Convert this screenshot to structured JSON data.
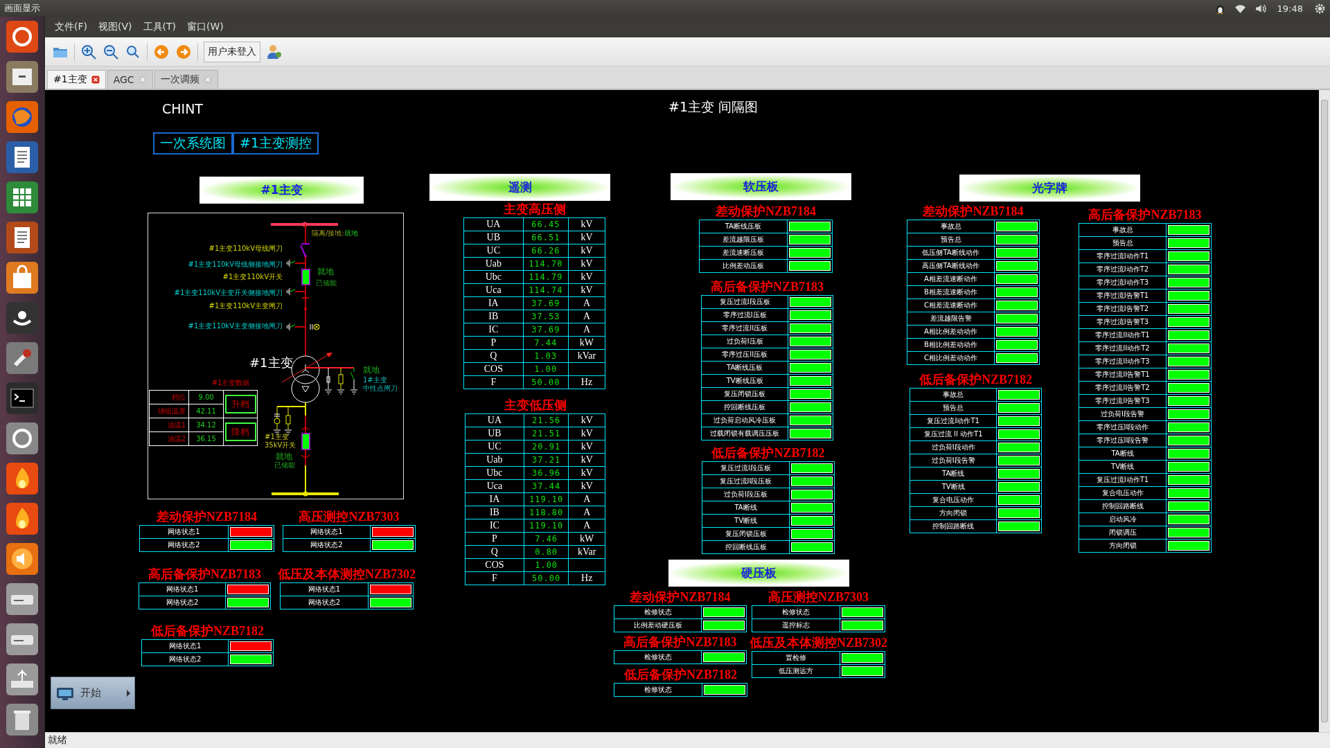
{
  "top_bar": {
    "title": "画面显示",
    "time": "19:48"
  },
  "menu": [
    "文件(F)",
    "视图(V)",
    "工具(T)",
    "窗口(W)"
  ],
  "toolbar": {
    "user_button": "用户未登入"
  },
  "tabs": [
    {
      "label": "#1主变",
      "selected": true
    },
    {
      "label": "AGC",
      "selected": false
    },
    {
      "label": "一次调频",
      "selected": false
    }
  ],
  "canvas": {
    "logo": "CHINT",
    "title": "#1主变 间隔图",
    "nav_buttons": [
      "一次系统图",
      "#1主变测控"
    ],
    "start_button": "开始"
  },
  "diagram": {
    "header": "#1主变",
    "isolation_label": "隔离/接地:",
    "isolation_mode": "就地",
    "device_labels": [
      {
        "text": "#1主变110kV母线闸刀",
        "kind": "switch"
      },
      {
        "text": "#1主变110kV母线侧接地闸刀",
        "kind": "ground_switch"
      },
      {
        "text": "#1主变110kV开关",
        "kind": "switch"
      },
      {
        "text": "#1主变110kV主变开关侧接地闸刀",
        "kind": "ground_switch"
      },
      {
        "text": "#1主变110kV主变闸刀",
        "kind": "switch"
      },
      {
        "text": "#1主变110kV主变侧接地闸刀",
        "kind": "ground_switch"
      }
    ],
    "breaker_110": {
      "mode": "就地",
      "status": "已储能"
    },
    "transformer": "#1主变",
    "neutral": {
      "mode": "就地",
      "name_1": "1#主变",
      "name_2": "中性点闸刀"
    },
    "breaker_35": {
      "name_1": "#1主变",
      "name_2": "35kV开关",
      "mode": "就地",
      "status": "已储能"
    },
    "data_title": "#1主变数据",
    "data": [
      {
        "label": "档位",
        "value": "9.00"
      },
      {
        "label": "绕组温度",
        "value": "42.11"
      },
      {
        "label": "油温1",
        "value": "34.12"
      },
      {
        "label": "油温2",
        "value": "36.15"
      }
    ],
    "buttons": [
      "升档",
      "降档"
    ]
  },
  "network_status": {
    "groups": [
      {
        "title": "差动保护NZB7184",
        "rows": [
          {
            "label": "网络状态1",
            "color": "#ff0000"
          },
          {
            "label": "网络状态2",
            "color": "#00ff00"
          }
        ]
      },
      {
        "title": "高压测控NZB7303",
        "rows": [
          {
            "label": "网络状态1",
            "color": "#ff0000"
          },
          {
            "label": "网络状态2",
            "color": "#00ff00"
          }
        ]
      },
      {
        "title": "高后备保护NZB7183",
        "rows": [
          {
            "label": "网络状态1",
            "color": "#ff0000"
          },
          {
            "label": "网络状态2",
            "color": "#00ff00"
          }
        ]
      },
      {
        "title": "低压及本体测控NZB7302",
        "rows": [
          {
            "label": "网络状态1",
            "color": "#ff0000"
          },
          {
            "label": "网络状态2",
            "color": "#00ff00"
          }
        ]
      },
      {
        "title": "低后备保护NZB7182",
        "rows": [
          {
            "label": "网络状态1",
            "color": "#ff0000"
          },
          {
            "label": "网络状态2",
            "color": "#00ff00"
          }
        ]
      }
    ]
  },
  "telemetry": {
    "header": "遥测",
    "groups": [
      {
        "title": "主变高压侧",
        "rows": [
          {
            "label": "UA",
            "value": "66.45",
            "unit": "kV"
          },
          {
            "label": "UB",
            "value": "66.51",
            "unit": "kV"
          },
          {
            "label": "UC",
            "value": "66.26",
            "unit": "kV"
          },
          {
            "label": "Uab",
            "value": "114.70",
            "unit": "kV"
          },
          {
            "label": "Ubc",
            "value": "114.79",
            "unit": "kV"
          },
          {
            "label": "Uca",
            "value": "114.74",
            "unit": "kV"
          },
          {
            "label": "IA",
            "value": "37.69",
            "unit": "A"
          },
          {
            "label": "IB",
            "value": "37.53",
            "unit": "A"
          },
          {
            "label": "IC",
            "value": "37.69",
            "unit": "A"
          },
          {
            "label": "P",
            "value": "7.44",
            "unit": "kW"
          },
          {
            "label": "Q",
            "value": "1.03",
            "unit": "kVar"
          },
          {
            "label": "COS",
            "value": "1.00"
          },
          {
            "label": "F",
            "value": "50.00",
            "unit": "Hz"
          }
        ]
      },
      {
        "title": "主变低压侧",
        "rows": [
          {
            "label": "UA",
            "value": "21.56",
            "unit": "kV"
          },
          {
            "label": "UB",
            "value": "21.51",
            "unit": "kV"
          },
          {
            "label": "UC",
            "value": "20.91",
            "unit": "kV"
          },
          {
            "label": "Uab",
            "value": "37.21",
            "unit": "kV"
          },
          {
            "label": "Ubc",
            "value": "36.96",
            "unit": "kV"
          },
          {
            "label": "Uca",
            "value": "37.44",
            "unit": "kV"
          },
          {
            "label": "IA",
            "value": "119.10",
            "unit": "A"
          },
          {
            "label": "IB",
            "value": "118.80",
            "unit": "A"
          },
          {
            "label": "IC",
            "value": "119.10",
            "unit": "A"
          },
          {
            "label": "P",
            "value": "7.46",
            "unit": "kW"
          },
          {
            "label": "Q",
            "value": "0.80",
            "unit": "kVar"
          },
          {
            "label": "COS",
            "value": "1.00"
          },
          {
            "label": "F",
            "value": "50.00",
            "unit": "Hz"
          }
        ]
      }
    ]
  },
  "soft_plates": {
    "header": "软压板",
    "groups": [
      {
        "title": "差动保护NZB7184",
        "rows": [
          {
            "label": "TA断线压板",
            "color": "#00ff00"
          },
          {
            "label": "差流越限压板",
            "color": "#00ff00"
          },
          {
            "label": "差流速断压板",
            "color": "#00ff00"
          },
          {
            "label": "比例差动压板",
            "color": "#00ff00"
          }
        ]
      },
      {
        "title": "高后备保护NZB7183",
        "rows": [
          {
            "label": "复压过流I段压板",
            "color": "#00ff00"
          },
          {
            "label": "零序过流I压板",
            "color": "#00ff00"
          },
          {
            "label": "零序过流II压板",
            "color": "#00ff00"
          },
          {
            "label": "过负荷I压板",
            "color": "#00ff00"
          },
          {
            "label": "零序过压II压板",
            "color": "#00ff00"
          },
          {
            "label": "TA断线压板",
            "color": "#00ff00"
          },
          {
            "label": "TV断线压板",
            "color": "#00ff00"
          },
          {
            "label": "复压闭锁压板",
            "color": "#00ff00"
          },
          {
            "label": "控回断线压板",
            "color": "#00ff00"
          },
          {
            "label": "过负荷启动风冷压板",
            "color": "#00ff00"
          },
          {
            "label": "过载闭锁有载调压压板",
            "color": "#00ff00"
          }
        ]
      },
      {
        "title": "低后备保护NZB7182",
        "rows": [
          {
            "label": "复压过流I段压板",
            "color": "#00ff00"
          },
          {
            "label": "复压过流II段压板",
            "color": "#00ff00"
          },
          {
            "label": "过负荷I段压板",
            "color": "#00ff00"
          },
          {
            "label": "TA断线",
            "color": "#00ff00"
          },
          {
            "label": "TV断线",
            "color": "#00ff00"
          },
          {
            "label": "复压闭锁压板",
            "color": "#00ff00"
          },
          {
            "label": "控回断线压板",
            "color": "#00ff00"
          }
        ]
      }
    ]
  },
  "hard_plates": {
    "header": "硬压板",
    "groups": [
      {
        "title": "差动保护NZB7184",
        "rows": [
          {
            "label": "检修状态",
            "color": "#00ff00"
          },
          {
            "label": "比例差动硬压板",
            "color": "#00ff00"
          }
        ]
      },
      {
        "title": "高压测控NZB7303",
        "rows": [
          {
            "label": "检修状态",
            "color": "#00ff00"
          },
          {
            "label": "遥控标志",
            "color": "#00ff00"
          }
        ]
      },
      {
        "title": "高后备保护NZB7183",
        "rows": [
          {
            "label": "检修状态",
            "color": "#00ff00"
          }
        ]
      },
      {
        "title": "低压及本体测控NZB7302",
        "rows": [
          {
            "label": "置检修",
            "color": "#00ff00"
          },
          {
            "label": "低压测远方",
            "color": "#00ff00"
          }
        ]
      },
      {
        "title": "低后备保护NZB7182",
        "rows": [
          {
            "label": "检修状态",
            "color": "#00ff00"
          }
        ]
      }
    ]
  },
  "lights": {
    "header": "光字牌",
    "groups": [
      {
        "title": "差动保护NZB7184",
        "rows": [
          {
            "label": "事故总",
            "color": "#00ff00"
          },
          {
            "label": "预告总",
            "color": "#00ff00"
          },
          {
            "label": "低压侧TA断线动作",
            "color": "#00ff00"
          },
          {
            "label": "高压侧TA断线动作",
            "color": "#00ff00"
          },
          {
            "label": "A相差流速断动作",
            "color": "#00ff00"
          },
          {
            "label": "B相差流速断动作",
            "color": "#00ff00"
          },
          {
            "label": "C相差流速断动作",
            "color": "#00ff00"
          },
          {
            "label": "差流越限告警",
            "color": "#00ff00"
          },
          {
            "label": "A相比例差动动作",
            "color": "#00ff00"
          },
          {
            "label": "B相比例差动动作",
            "color": "#00ff00"
          },
          {
            "label": "C相比例差动动作",
            "color": "#00ff00"
          }
        ]
      },
      {
        "title": "低后备保护NZB7182",
        "rows": [
          {
            "label": "事故总",
            "color": "#00ff00"
          },
          {
            "label": "预告总",
            "color": "#00ff00"
          },
          {
            "label": "复压过流I动作T1",
            "color": "#00ff00"
          },
          {
            "label": "复压过流 II 动作T1",
            "color": "#00ff00"
          },
          {
            "label": "过负荷I段动作",
            "color": "#00ff00"
          },
          {
            "label": "过负荷I段告警",
            "color": "#00ff00"
          },
          {
            "label": "TA断线",
            "color": "#00ff00"
          },
          {
            "label": "TV断线",
            "color": "#00ff00"
          },
          {
            "label": "复合电压动作",
            "color": "#00ff00"
          },
          {
            "label": "方向闭锁",
            "color": "#00ff00"
          },
          {
            "label": "控制回路断线",
            "color": "#00ff00"
          }
        ]
      },
      {
        "title": "高后备保护NZB7183",
        "rows": [
          {
            "label": "事故总",
            "color": "#00ff00"
          },
          {
            "label": "预告总",
            "color": "#00ff00"
          },
          {
            "label": "零序过流I动作T1",
            "color": "#00ff00"
          },
          {
            "label": "零序过流I动作T2",
            "color": "#00ff00"
          },
          {
            "label": "零序过流I动作T3",
            "color": "#00ff00"
          },
          {
            "label": "零序过流I告警T1",
            "color": "#00ff00"
          },
          {
            "label": "零序过流I告警T2",
            "color": "#00ff00"
          },
          {
            "label": "零序过流I告警T3",
            "color": "#00ff00"
          },
          {
            "label": "零序过流II动作T1",
            "color": "#00ff00"
          },
          {
            "label": "零序过流II动作T2",
            "color": "#00ff00"
          },
          {
            "label": "零序过流II动作T3",
            "color": "#00ff00"
          },
          {
            "label": "零序过流II告警T1",
            "color": "#00ff00"
          },
          {
            "label": "零序过流II告警T2",
            "color": "#00ff00"
          },
          {
            "label": "零序过流II告警T3",
            "color": "#00ff00"
          },
          {
            "label": "过负荷I段告警",
            "color": "#00ff00"
          },
          {
            "label": "零序过压II段动作",
            "color": "#00ff00"
          },
          {
            "label": "零序过压II段告警",
            "color": "#00ff00"
          },
          {
            "label": "TA断线",
            "color": "#00ff00"
          },
          {
            "label": "TV断线",
            "color": "#00ff00"
          },
          {
            "label": "复压过流I动作T1",
            "color": "#00ff00"
          },
          {
            "label": "复合电压动作",
            "color": "#00ff00"
          },
          {
            "label": "控制回路断线",
            "color": "#00ff00"
          },
          {
            "label": "启动风冷",
            "color": "#00ff00"
          },
          {
            "label": "闭锁调压",
            "color": "#00ff00"
          },
          {
            "label": "方向闭锁",
            "color": "#00ff00"
          }
        ]
      }
    ]
  },
  "status_bar": "就绪"
}
